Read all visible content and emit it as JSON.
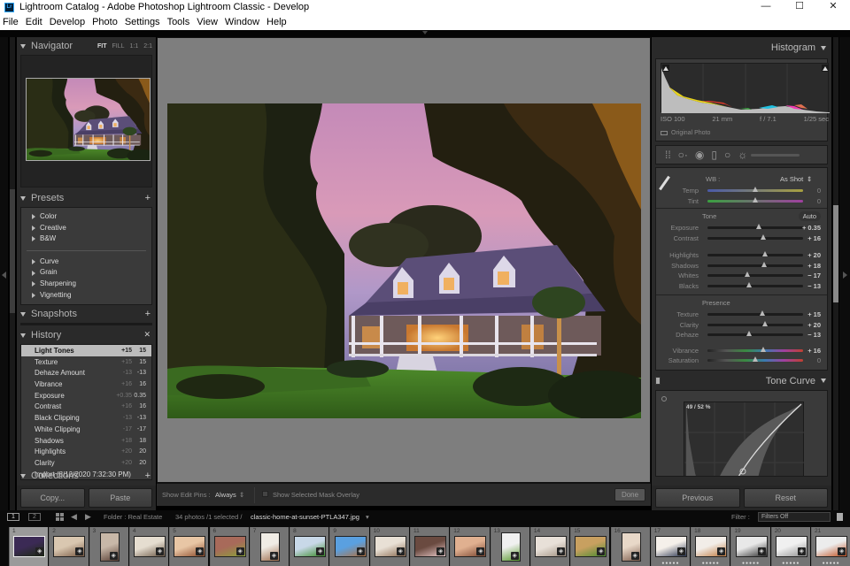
{
  "window": {
    "title": "Lightroom Catalog - Adobe Photoshop Lightroom Classic - Develop",
    "app_icon": "Lr",
    "controls": {
      "minimize": "—",
      "maximize": "☐",
      "close": "✕"
    }
  },
  "menu": [
    "File",
    "Edit",
    "Develop",
    "Photo",
    "Settings",
    "Tools",
    "View",
    "Window",
    "Help"
  ],
  "left_panel": {
    "navigator": {
      "title": "Navigator",
      "zoom_options": [
        "FIT",
        "FILL",
        "1:1",
        "2:1"
      ],
      "active_zoom": "FIT"
    },
    "presets": {
      "title": "Presets",
      "add": "+",
      "groups_a": [
        "Color",
        "Creative",
        "B&W"
      ],
      "groups_b": [
        "Curve",
        "Grain",
        "Sharpening",
        "Vignetting"
      ]
    },
    "snapshots": {
      "title": "Snapshots",
      "add": "+"
    },
    "history": {
      "title": "History",
      "clear": "✕",
      "items": [
        {
          "name": "Light Tones",
          "delta": "+15",
          "value": "15",
          "selected": true
        },
        {
          "name": "Texture",
          "delta": "+15",
          "value": "15"
        },
        {
          "name": "Dehaze Amount",
          "delta": "-13",
          "value": "-13"
        },
        {
          "name": "Vibrance",
          "delta": "+16",
          "value": "16"
        },
        {
          "name": "Exposure",
          "delta": "+0.35",
          "value": "0.35"
        },
        {
          "name": "Contrast",
          "delta": "+16",
          "value": "16"
        },
        {
          "name": "Black Clipping",
          "delta": "-13",
          "value": "-13"
        },
        {
          "name": "White Clipping",
          "delta": "-17",
          "value": "-17"
        },
        {
          "name": "Shadows",
          "delta": "+18",
          "value": "18"
        },
        {
          "name": "Highlights",
          "delta": "+20",
          "value": "20"
        },
        {
          "name": "Clarity",
          "delta": "+20",
          "value": "20"
        },
        {
          "name": "Import (8/12/2020 7:32:30 PM)",
          "delta": "",
          "value": ""
        }
      ]
    },
    "collections": {
      "title": "Collections",
      "add": "+"
    },
    "copy_button": "Copy...",
    "paste_button": "Paste"
  },
  "toolbar": {
    "show_edit_pins_label": "Show Edit Pins :",
    "show_edit_pins_value": "Always",
    "mask_overlay_label": "Show Selected Mask Overlay",
    "mask_overlay_checked": false,
    "done_button": "Done"
  },
  "right_panel": {
    "histogram": {
      "title": "Histogram",
      "iso": "ISO 100",
      "focal_length": "21 mm",
      "aperture": "f / 7.1",
      "shutter": "1/25 sec",
      "original_photo_label": "Original Photo"
    },
    "basic": {
      "wb_label": "WB :",
      "wb_value": "As Shot",
      "temp": {
        "label": "Temp",
        "value": "0",
        "pos": 0.5
      },
      "tint": {
        "label": "Tint",
        "value": "0",
        "pos": 0.5
      },
      "tone_title": "Tone",
      "auto_button": "Auto",
      "tone": [
        {
          "label": "Exposure",
          "value": "+ 0.35",
          "pos": 0.535
        },
        {
          "label": "Contrast",
          "value": "+ 16",
          "pos": 0.58
        }
      ],
      "tone2": [
        {
          "label": "Highlights",
          "value": "+ 20",
          "pos": 0.6
        },
        {
          "label": "Shadows",
          "value": "+ 18",
          "pos": 0.59
        },
        {
          "label": "Whites",
          "value": "− 17",
          "pos": 0.415
        },
        {
          "label": "Blacks",
          "value": "− 13",
          "pos": 0.435
        }
      ],
      "presence_title": "Presence",
      "presence": [
        {
          "label": "Texture",
          "value": "+ 15",
          "pos": 0.575
        },
        {
          "label": "Clarity",
          "value": "+ 20",
          "pos": 0.6
        },
        {
          "label": "Dehaze",
          "value": "− 13",
          "pos": 0.435
        }
      ],
      "presence2": [
        {
          "label": "Vibrance",
          "value": "+ 16",
          "pos": 0.58
        },
        {
          "label": "Saturation",
          "value": "0",
          "pos": 0.5
        }
      ]
    },
    "tone_curve": {
      "title": "Tone Curve",
      "readout": "49 / 52 %"
    },
    "previous_button": "Previous",
    "reset_button": "Reset"
  },
  "filmstrip_bar": {
    "page1": "1",
    "page2": "2",
    "folder": "Folder : Real Estate",
    "count": "34 photos /1 selected /",
    "filename": "classic-home-at-sunset-PTLA347.jpg",
    "filter_label": "Filter :",
    "filter_value": "Filters Off"
  },
  "filmstrip": {
    "selected": 1,
    "items": [
      {
        "n": "1",
        "c1": "#3b2a55",
        "c2": "#1c2a10",
        "portrait": false,
        "stars": false
      },
      {
        "n": "2",
        "c1": "#d9c7b0",
        "c2": "#7a5b45",
        "portrait": false,
        "stars": false
      },
      {
        "n": "3",
        "c1": "#c8b8a8",
        "c2": "#5a4035",
        "portrait": true,
        "stars": false
      },
      {
        "n": "4",
        "c1": "#e5ddd0",
        "c2": "#6d5a48",
        "portrait": false,
        "stars": false
      },
      {
        "n": "5",
        "c1": "#e8c6a5",
        "c2": "#8b4a2a",
        "portrait": false,
        "stars": false
      },
      {
        "n": "6",
        "c1": "#a86a5a",
        "c2": "#8aa03a",
        "portrait": false,
        "stars": false
      },
      {
        "n": "7",
        "c1": "#f0ece5",
        "c2": "#a07050",
        "portrait": true,
        "stars": false
      },
      {
        "n": "8",
        "c1": "#c8d8e8",
        "c2": "#3a8a2a",
        "portrait": false,
        "stars": false
      },
      {
        "n": "9",
        "c1": "#5aa0e0",
        "c2": "#b07040",
        "portrait": false,
        "stars": false
      },
      {
        "n": "10",
        "c1": "#e8e0d5",
        "c2": "#8a6a50",
        "portrait": false,
        "stars": false
      },
      {
        "n": "11",
        "c1": "#6a4a40",
        "c2": "#e8c8c8",
        "portrait": false,
        "stars": false
      },
      {
        "n": "12",
        "c1": "#e0b090",
        "c2": "#7a4530",
        "portrait": false,
        "stars": false
      },
      {
        "n": "13",
        "c1": "#f0f0f0",
        "c2": "#5a9a30",
        "portrait": true,
        "stars": false
      },
      {
        "n": "14",
        "c1": "#e8e0d8",
        "c2": "#a09080",
        "portrait": false,
        "stars": false
      },
      {
        "n": "15",
        "c1": "#c8a060",
        "c2": "#4a8a30",
        "portrait": false,
        "stars": false
      },
      {
        "n": "16",
        "c1": "#e8d8c8",
        "c2": "#806050",
        "portrait": true,
        "stars": false
      },
      {
        "n": "17",
        "c1": "#f5f0ea",
        "c2": "#2a3550",
        "portrait": false,
        "stars": true
      },
      {
        "n": "18",
        "c1": "#f2ede8",
        "c2": "#c07a40",
        "portrait": false,
        "stars": true
      },
      {
        "n": "19",
        "c1": "#e8e8e8",
        "c2": "#303030",
        "portrait": false,
        "stars": true
      },
      {
        "n": "20",
        "c1": "#f0f0f0",
        "c2": "#909090",
        "portrait": false,
        "stars": true
      },
      {
        "n": "21",
        "c1": "#ececec",
        "c2": "#c05020",
        "portrait": false,
        "stars": true
      }
    ]
  },
  "colors": {
    "panel": "#2a2a2a",
    "canvas": "#7e7e7e",
    "accent_light": "#bcbcbc"
  }
}
